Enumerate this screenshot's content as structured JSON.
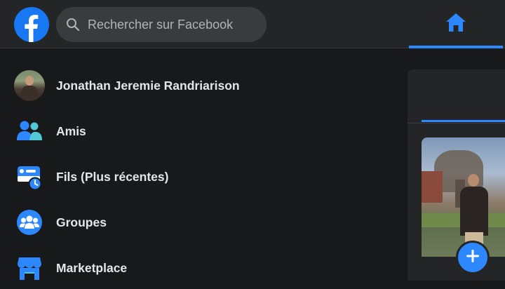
{
  "header": {
    "logo_icon": "facebook-logo-icon",
    "search": {
      "placeholder": "Rechercher sur Facebook",
      "icon": "search-icon"
    },
    "active_tab": {
      "icon": "home-icon"
    }
  },
  "sidebar": {
    "items": [
      {
        "label": "Jonathan Jeremie Randriarison",
        "icon": "profile-avatar"
      },
      {
        "label": "Amis",
        "icon": "friends-icon"
      },
      {
        "label": "Fils (Plus récentes)",
        "icon": "feeds-icon"
      },
      {
        "label": "Groupes",
        "icon": "groups-icon"
      },
      {
        "label": "Marketplace",
        "icon": "marketplace-icon"
      }
    ]
  },
  "stories": {
    "add_icon": "plus-icon"
  },
  "colors": {
    "accent": "#2d88ff",
    "brand": "#1877f2",
    "background": "#18191a",
    "surface": "#242526"
  }
}
